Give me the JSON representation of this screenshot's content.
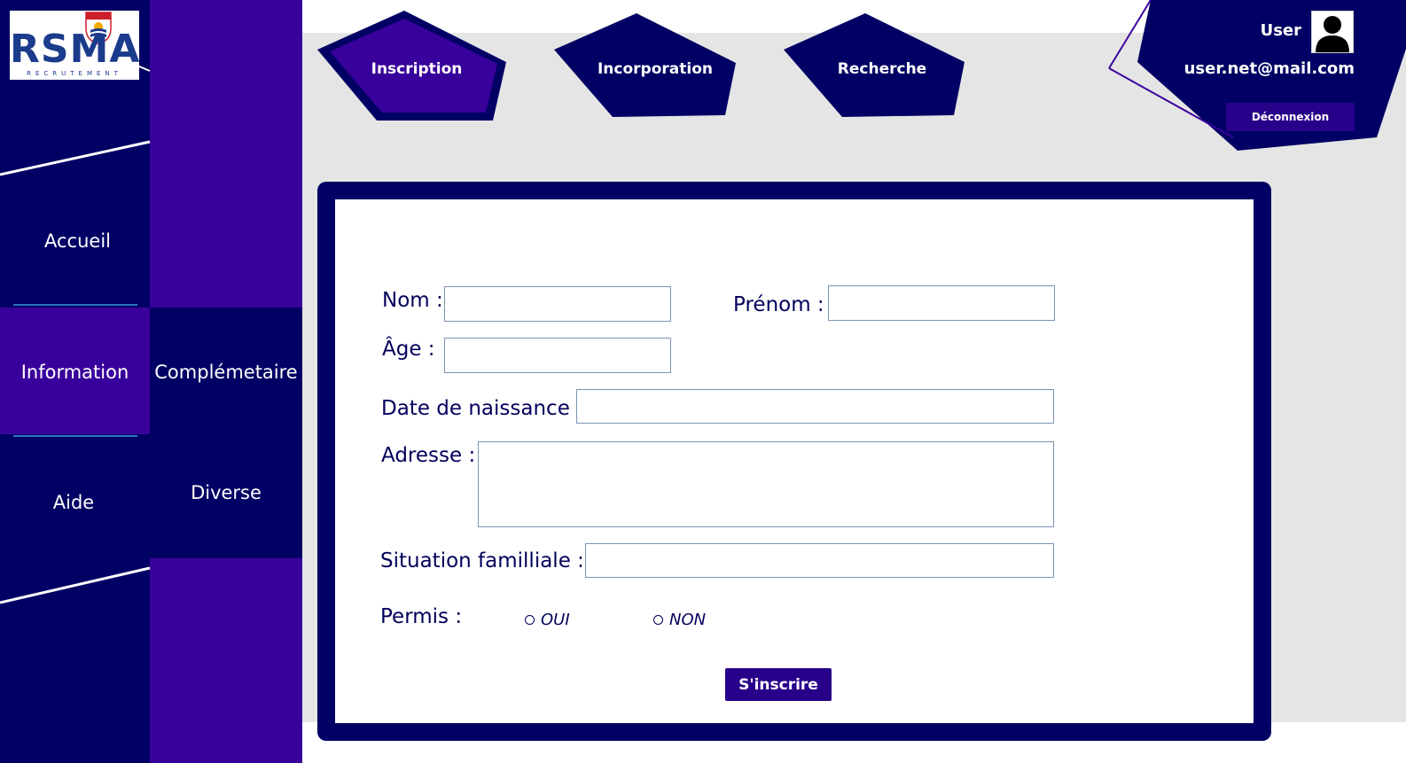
{
  "brand": {
    "logo_text": "RSMA",
    "logo_subtext": "RECRUTEMENT"
  },
  "sidebar": {
    "items": [
      {
        "label": "Accueil"
      },
      {
        "label": "Information"
      },
      {
        "label": "Aide"
      }
    ],
    "subitems": [
      {
        "label": "Complémetaire"
      },
      {
        "label": "Diverse"
      }
    ]
  },
  "nav": {
    "tabs": [
      {
        "label": "Inscription",
        "active": true
      },
      {
        "label": "Incorporation"
      },
      {
        "label": "Recherche"
      }
    ]
  },
  "user": {
    "name": "User",
    "email": "user.net@mail.com",
    "logout_label": "Déconnexion"
  },
  "form": {
    "nom_label": "Nom :",
    "prenom_label": "Prénom :",
    "age_label": "Âge :",
    "date_label": "Date de naissance :",
    "adresse_label": "Adresse :",
    "situation_label": "Situation familliale :",
    "permis_label": "Permis :",
    "permis_options": [
      {
        "label": "OUI"
      },
      {
        "label": "NON"
      }
    ],
    "submit_label": "S'inscrire"
  },
  "colors": {
    "navy": "#010064",
    "purple": "#39019b",
    "button": "#28018a",
    "background_gray": "#e5e5e5"
  }
}
